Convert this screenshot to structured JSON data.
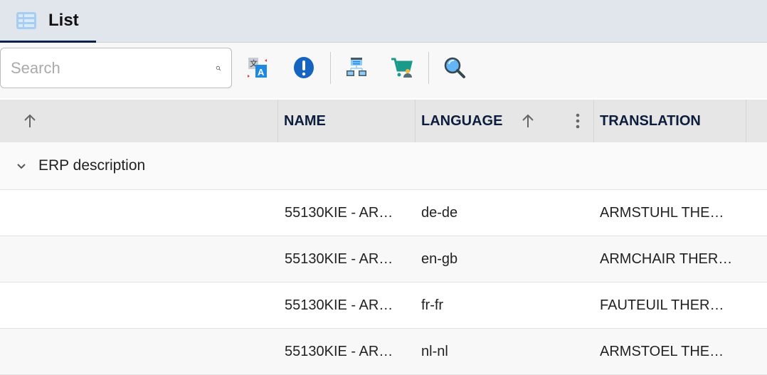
{
  "tab": {
    "label": "List"
  },
  "search": {
    "placeholder": "Search",
    "value": ""
  },
  "toolbar": {
    "icons": [
      "translate-icon",
      "info-icon",
      "network-icon",
      "cart-icon",
      "zoom-search-icon"
    ]
  },
  "table": {
    "columns": [
      "NAME",
      "LANGUAGE",
      "TRANSLATION"
    ],
    "group": "ERP description",
    "rows": [
      {
        "name": "55130KIE - AR…",
        "language": "de-de",
        "translation": "ARMSTUHL THE…"
      },
      {
        "name": "55130KIE - AR…",
        "language": "en-gb",
        "translation": "ARMCHAIR THER…"
      },
      {
        "name": "55130KIE - AR…",
        "language": "fr-fr",
        "translation": "FAUTEUIL THER…"
      },
      {
        "name": "55130KIE - AR…",
        "language": "nl-nl",
        "translation": "ARMSTOEL THE…"
      }
    ]
  },
  "colors": {
    "accent": "#0d2147",
    "header_text": "#0d1e3d",
    "info": "#1565c0",
    "cart": "#1a9a8a"
  }
}
